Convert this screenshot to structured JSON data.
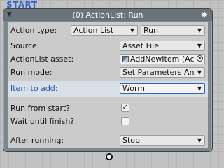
{
  "canvas": {
    "start_label": "START"
  },
  "node": {
    "title": "(0) ActionList: Run",
    "collapse_glyph": "▼",
    "settings_glyph": "✸"
  },
  "fields": {
    "action_type": {
      "label": "Action type:",
      "category_value": "Action List",
      "action_value": "Run"
    },
    "source": {
      "label": "Source:",
      "value": "Asset File"
    },
    "actionlist_asset": {
      "label": "ActionList asset:",
      "value": "AddNewItem (Ac"
    },
    "run_mode": {
      "label": "Run mode:",
      "value": "Set Parameters And"
    },
    "item_to_add": {
      "label": "Item to add:",
      "value": "Worm"
    },
    "run_from_start": {
      "label": "Run from start?",
      "checked": true,
      "check_glyph": "✓"
    },
    "wait_until_finish": {
      "label": "Wait until finish?",
      "checked": false,
      "check_glyph": ""
    },
    "after_running": {
      "label": "After running:",
      "value": "Stop"
    }
  },
  "dropdown_arrow": "▼"
}
